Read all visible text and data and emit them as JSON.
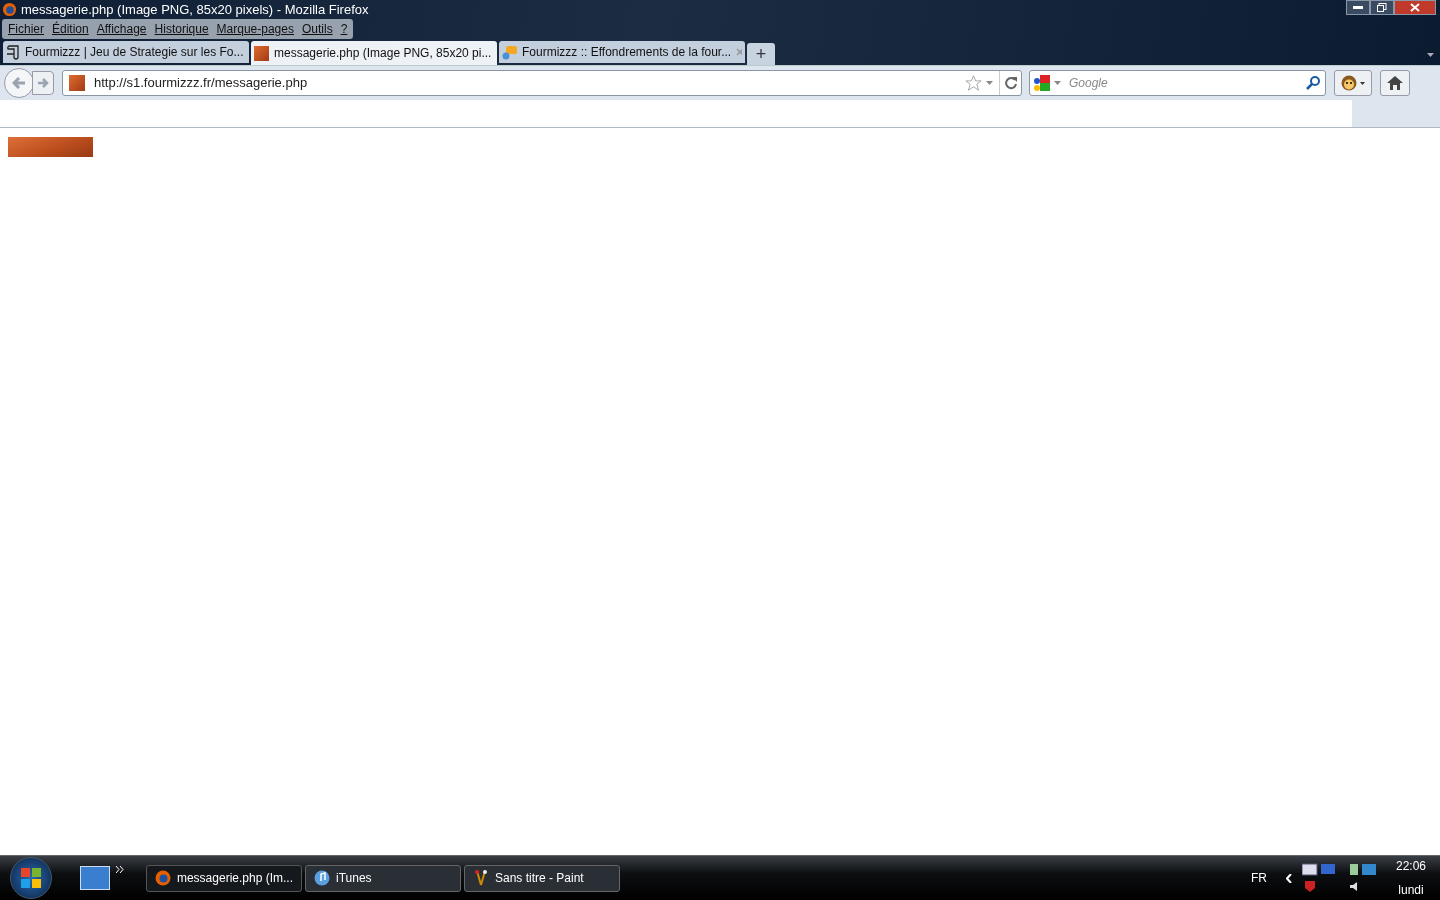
{
  "window": {
    "title": "messagerie.php (Image PNG, 85x20 pixels) - Mozilla Firefox"
  },
  "menu": [
    "Fichier",
    "Édition",
    "Affichage",
    "Historique",
    "Marque-pages",
    "Outils",
    "?"
  ],
  "tabs": [
    {
      "label": "Fourmizzz | Jeu de Strategie sur les Fo...",
      "selected": false,
      "kind": "script"
    },
    {
      "label": "messagerie.php (Image PNG, 85x20 pi...",
      "selected": true,
      "kind": "image"
    },
    {
      "label": "Fourmizzz :: Effondrements de la four...",
      "selected": false,
      "kind": "forum"
    }
  ],
  "new_tab": "+",
  "address_bar": {
    "url": "http://s1.fourmizzz.fr/messagerie.php"
  },
  "search": {
    "placeholder": "Google"
  },
  "taskbar": {
    "tasks": [
      {
        "label": "messagerie.php (Im...",
        "selected": true,
        "kind": "firefox"
      },
      {
        "label": "iTunes",
        "selected": false,
        "kind": "itunes"
      },
      {
        "label": "Sans titre - Paint",
        "selected": false,
        "kind": "paint"
      }
    ],
    "language": "FR",
    "time": "22:06",
    "day": "lundi"
  }
}
